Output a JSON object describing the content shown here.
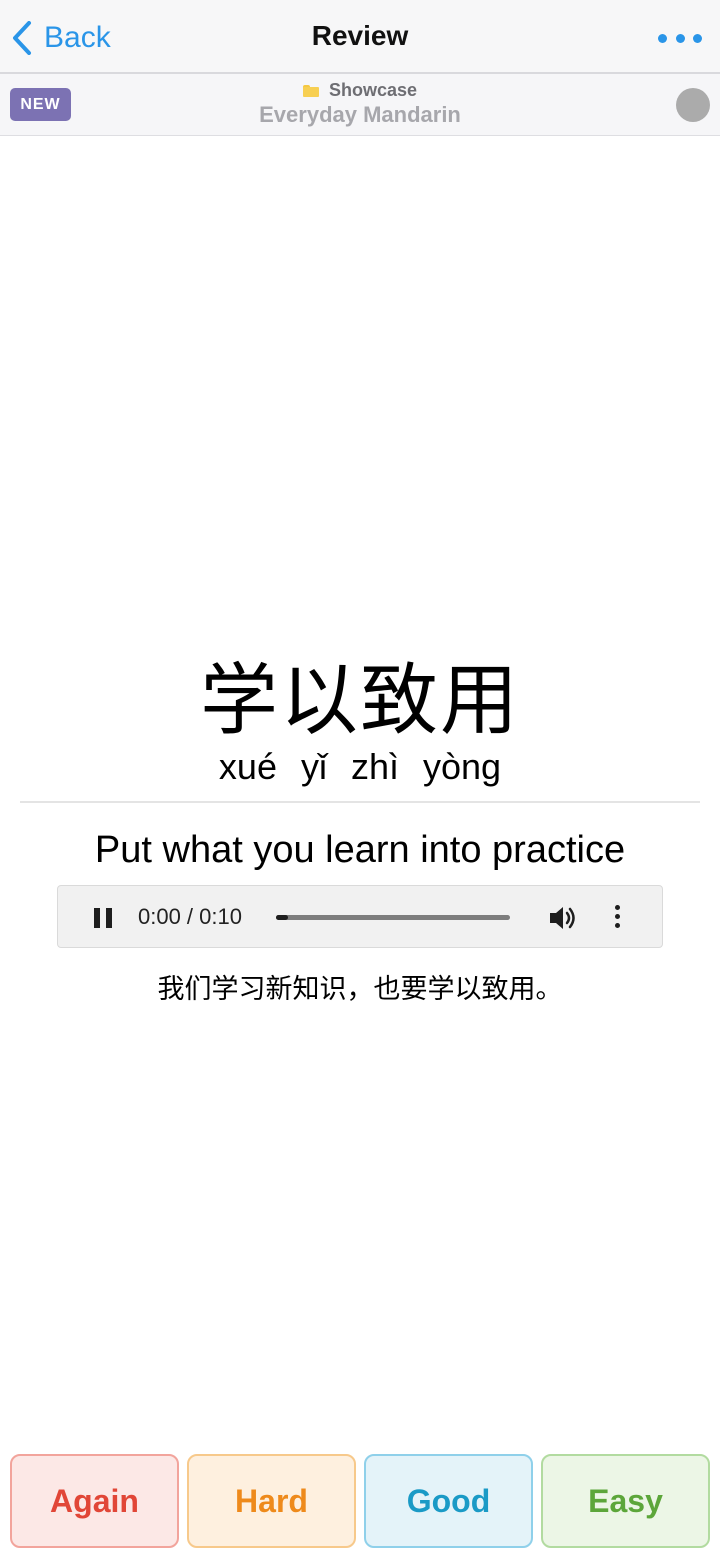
{
  "nav": {
    "back_label": "Back",
    "title": "Review",
    "accent_color": "#2a95e8",
    "more_icon": "ellipsis-icon"
  },
  "deck": {
    "badge": "NEW",
    "folder_icon": "folder-icon",
    "folder": "Showcase",
    "name": "Everyday Mandarin"
  },
  "card": {
    "hanzi": "学以致用",
    "pinyin": "xué yǐ zhì yòng",
    "meaning": "Put what you learn into practice",
    "example": "我们学习新知识，也要学以致用。"
  },
  "audio": {
    "state": "playing",
    "time": "0:00 / 0:10",
    "progress": 0.05
  },
  "answers": {
    "again": "Again",
    "hard": "Hard",
    "good": "Good",
    "easy": "Easy"
  }
}
